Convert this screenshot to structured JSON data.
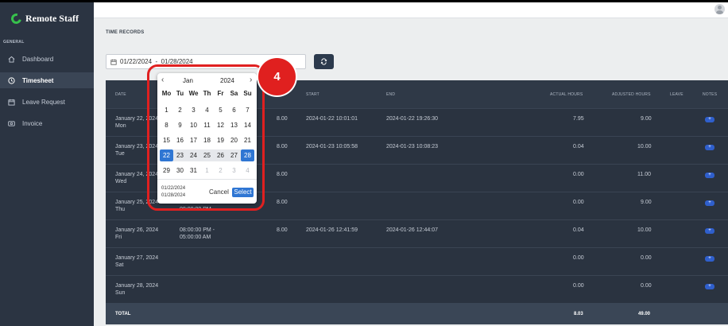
{
  "sidebar": {
    "brand": "Remote Staff",
    "section_label": "GENERAL",
    "items": [
      {
        "label": "Dashboard",
        "icon": "home-icon",
        "active": false
      },
      {
        "label": "Timesheet",
        "icon": "clock-icon",
        "active": true
      },
      {
        "label": "Leave Request",
        "icon": "calendar-icon",
        "active": false
      },
      {
        "label": "Invoice",
        "icon": "invoice-icon",
        "active": false
      }
    ]
  },
  "page": {
    "title": "TIME RECORDS",
    "date_range_value": "01/22/2024  -  01/28/2024"
  },
  "table": {
    "headers": {
      "date": "DATE",
      "start": "START",
      "end": "END",
      "actual_hours": "ACTUAL HOURS",
      "adjusted_hours": "ADJUSTED HOURS",
      "leave": "LEAVE",
      "notes": "NOTES"
    },
    "rows": [
      {
        "date": "January 22, 2024",
        "day": "Mon",
        "schedule1": "",
        "schedule2": "",
        "hours": "8.00",
        "start": "2024-01-22 10:01:01",
        "end": "2024-01-22 19:26:30",
        "actual": "7.95",
        "adjusted": "9.00",
        "note": "+"
      },
      {
        "date": "January 23, 2024",
        "day": "Tue",
        "schedule1": "",
        "schedule2": "",
        "hours": "8.00",
        "start": "2024-01-23 10:05:58",
        "end": "2024-01-23 10:08:23",
        "actual": "0.04",
        "adjusted": "10.00",
        "note": "+"
      },
      {
        "date": "January 24, 2024",
        "day": "Wed",
        "schedule1": "",
        "schedule2": "",
        "hours": "8.00",
        "start": "",
        "end": "",
        "actual": "0.00",
        "adjusted": "11.00",
        "note": "+"
      },
      {
        "date": "January 25, 2024",
        "day": "Thu",
        "schedule1": "",
        "schedule2": "08:00:00 PM",
        "hours": "8.00",
        "start": "",
        "end": "",
        "actual": "0.00",
        "adjusted": "9.00",
        "note": "+"
      },
      {
        "date": "January 26, 2024",
        "day": "Fri",
        "schedule1": "08:00:00 PM -",
        "schedule2": "05:00:00 AM",
        "hours": "8.00",
        "start": "2024-01-26 12:41:59",
        "end": "2024-01-26 12:44:07",
        "actual": "0.04",
        "adjusted": "10.00",
        "note": "+"
      },
      {
        "date": "January 27, 2024",
        "day": "Sat",
        "schedule1": "",
        "schedule2": "",
        "hours": "",
        "start": "",
        "end": "",
        "actual": "0.00",
        "adjusted": "0.00",
        "note": "+"
      },
      {
        "date": "January 28, 2024",
        "day": "Sun",
        "schedule1": "",
        "schedule2": "",
        "hours": "",
        "start": "",
        "end": "",
        "actual": "0.00",
        "adjusted": "0.00",
        "note": "+"
      }
    ],
    "total": {
      "label": "TOTAL",
      "actual": "8.03",
      "adjusted": "49.00"
    }
  },
  "datepicker": {
    "prev": "‹",
    "next": "›",
    "month": "Jan",
    "year": "2024",
    "weekdays": [
      "Mo",
      "Tu",
      "We",
      "Th",
      "Fr",
      "Sa",
      "Su"
    ],
    "weeks": [
      [
        "1",
        "2",
        "3",
        "4",
        "5",
        "6",
        "7"
      ],
      [
        "8",
        "9",
        "10",
        "11",
        "12",
        "13",
        "14"
      ],
      [
        "15",
        "16",
        "17",
        "18",
        "19",
        "20",
        "21"
      ],
      [
        "22",
        "23",
        "24",
        "25",
        "26",
        "27",
        "28"
      ],
      [
        "29",
        "30",
        "31",
        "1",
        "2",
        "3",
        "4"
      ]
    ],
    "range_start_text": "01/22/2024",
    "range_end_text": "01/28/2024",
    "cancel_label": "Cancel",
    "select_label": "Select"
  },
  "annotation": {
    "step_number": "4",
    "color": "#e0201f"
  }
}
